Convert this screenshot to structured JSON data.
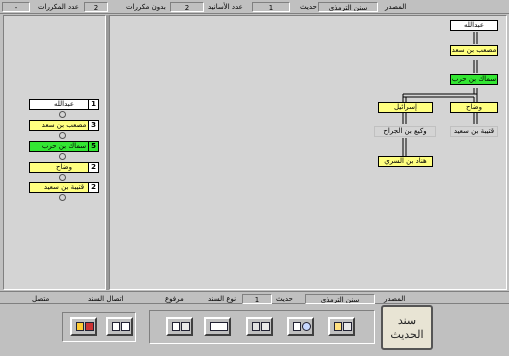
{
  "top_bar": {
    "source_label": "المصدر",
    "source_value": "سنن الترمذي",
    "hadith_label": "حديث",
    "hadith_number": "1",
    "isnad_count_label": "عدد الأسانيد",
    "isnad_count_value": "2",
    "no_repeat_label": "بدون مكررات",
    "repeat_count_label": "عدد المكررات",
    "repeat_count_value": "2",
    "right_extra": "-"
  },
  "left_panel": {
    "chain": [
      {
        "num": "1",
        "name": "عبدالله",
        "color": "white"
      },
      {
        "num": "3",
        "name": "مصعب بن سعد",
        "color": "yellow"
      },
      {
        "num": "5",
        "name": "سماك بن حرب",
        "color": "green"
      },
      {
        "num": "2",
        "name": "وضاح",
        "color": "yellow"
      },
      {
        "num": "2",
        "name": "قتيبة بن سعيد",
        "color": "yellow"
      }
    ]
  },
  "tree": {
    "root": "عبدالله",
    "level2": "مصعب بن سعد",
    "level3": "سماك بن حرب",
    "branch_right": "وضاح",
    "branch_right_child": "قتيبة بن سعيد",
    "branch_left": "إسرائيل",
    "branch_left_child": "وكيع بن الجراح",
    "branch_left_grandchild": "هناد بن السري"
  },
  "bottom_bar": {
    "source_label": "المصدر",
    "source_value": "سنن الترمذي",
    "hadith_label": "حديث",
    "hadith_number": "1",
    "sanad_type_label": "نوع السند",
    "sanad_type_value": "مرفوع",
    "continuity_label": "اتصال السند",
    "continuity_value": "متصل"
  },
  "logo": {
    "line1": "سند",
    "line2": "الحديث"
  },
  "colors": {
    "white_node": "#ffffff",
    "yellow_node": "#ffff80",
    "green_node": "#33e633",
    "panel": "#d4d4d4"
  }
}
